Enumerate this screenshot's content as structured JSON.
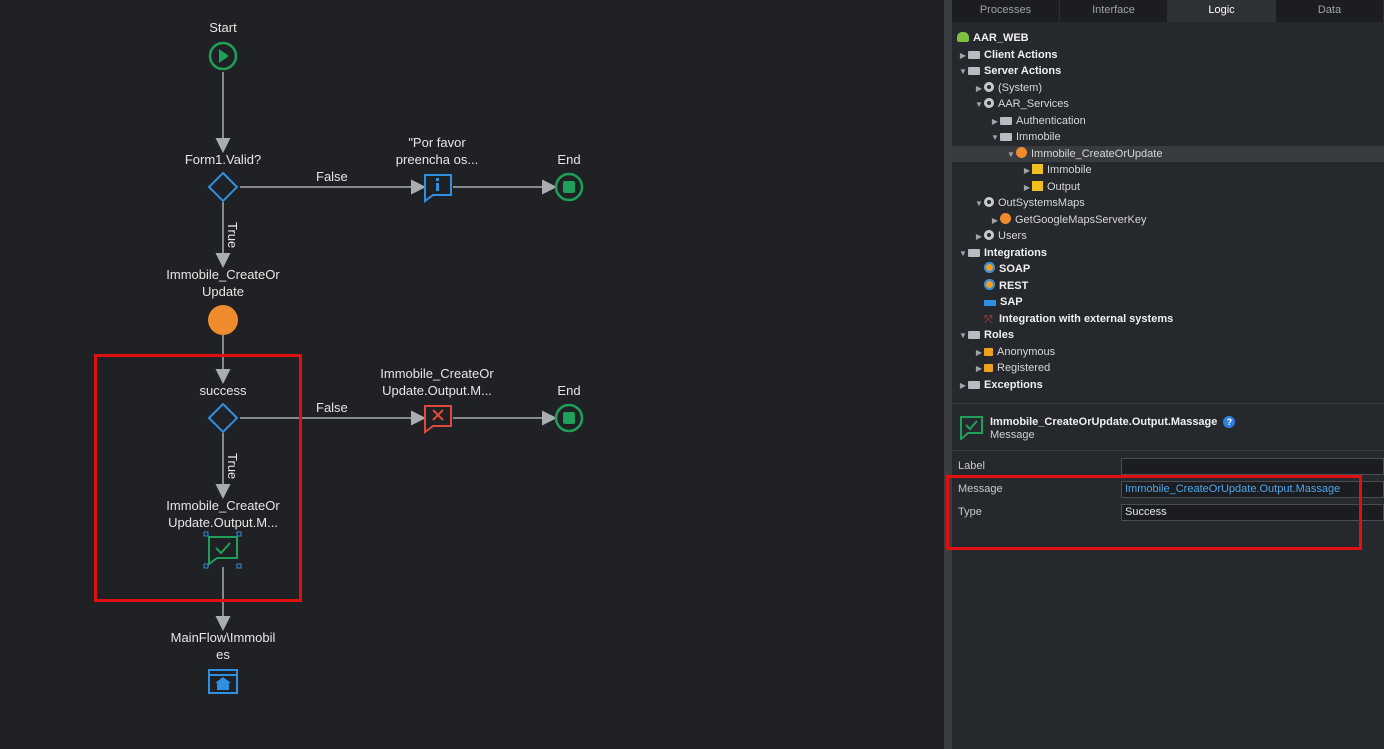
{
  "flow": {
    "start": "Start",
    "if1": "Form1.Valid?",
    "msg1": "\"Por favor\npreencha os...",
    "end1": "End",
    "false1": "False",
    "true1": "True",
    "action": "Immobile_CreateOr\nUpdate",
    "if2": "success",
    "msg2": "Immobile_CreateOr\nUpdate.Output.M...",
    "end2": "End",
    "false2": "False",
    "true2": "True",
    "msg3": "Immobile_CreateOr\nUpdate.Output.M...",
    "dest": "MainFlow\\Immobil\nes"
  },
  "tabs": [
    {
      "label": "Processes"
    },
    {
      "label": "Interface"
    },
    {
      "label": "Logic"
    },
    {
      "label": "Data"
    }
  ],
  "tree": {
    "root": "AAR_WEB",
    "client_actions": "Client Actions",
    "server_actions": "Server Actions",
    "system": "(System)",
    "aar_services": "AAR_Services",
    "authentication": "Authentication",
    "immobile": "Immobile",
    "create_or_update": "Immobile_CreateOrUpdate",
    "param_immobile": "Immobile",
    "param_output": "Output",
    "outsystems_maps": "OutSystemsMaps",
    "google_key": "GetGoogleMapsServerKey",
    "users": "Users",
    "integrations": "Integrations",
    "soap": "SOAP",
    "rest": "REST",
    "sap": "SAP",
    "external": "Integration with external systems",
    "roles": "Roles",
    "anonymous": "Anonymous",
    "registered": "Registered",
    "exceptions": "Exceptions"
  },
  "properties": {
    "title": "Immobile_CreateOrUpdate.Output.Massage",
    "subtitle": "Message",
    "label_key": "Label",
    "label_value": "",
    "message_key": "Message",
    "message_value": "Immobile_CreateOrUpdate.Output.Massage",
    "type_key": "Type",
    "type_value": "Success"
  },
  "colors": {
    "start_end": "#1fa05a",
    "if_blue": "#2f8fe0",
    "action_orange": "#ef8b2c",
    "error_red": "#e04a3a",
    "highlight": "#e01010"
  }
}
